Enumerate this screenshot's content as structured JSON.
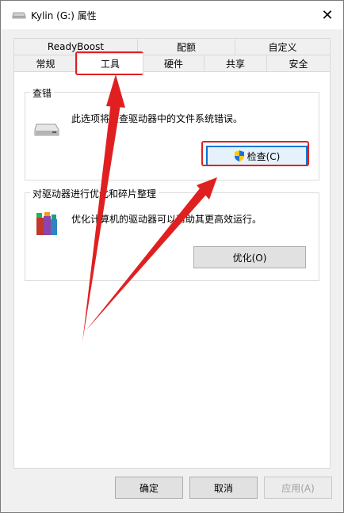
{
  "window": {
    "title": "Kylin (G:) 属性",
    "drive_icon": "drive-icon"
  },
  "tabs_top": [
    "ReadyBoost",
    "配额",
    "自定义"
  ],
  "tabs_bottom": [
    "常规",
    "工具",
    "硬件",
    "共享",
    "安全"
  ],
  "active_tab": "工具",
  "check_group": {
    "title": "查错",
    "description": "此选项将检查驱动器中的文件系统错误。",
    "button_label": "检查(C)",
    "icon": "drive-icon",
    "button_icon": "shield-icon"
  },
  "optimize_group": {
    "title": "对驱动器进行优化和碎片整理",
    "description": "优化计算机的驱动器可以帮助其更高效运行。",
    "button_label": "优化(O)",
    "icon": "defrag-icon"
  },
  "footer": {
    "ok": "确定",
    "cancel": "取消",
    "apply": "应用(A)"
  },
  "colors": {
    "annotation": "#e02020",
    "focus": "#0078d7"
  }
}
